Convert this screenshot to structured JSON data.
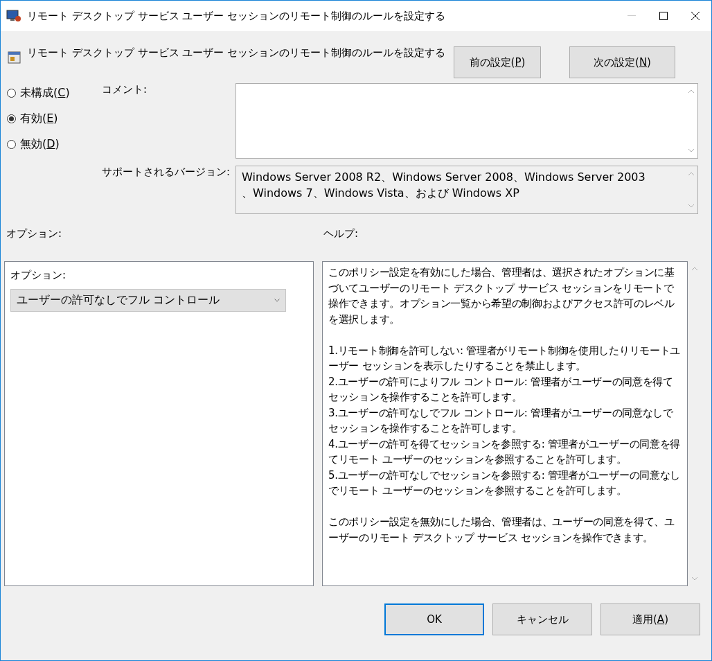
{
  "window": {
    "title": "リモート デスクトップ サービス ユーザー セッションのリモート制御のルールを設定する"
  },
  "policy_title": "リモート デスクトップ サービス ユーザー セッションのリモート制御のルールを設定する",
  "nav_buttons": [
    {
      "before": "前の設定(",
      "key": "P",
      "after": ")"
    },
    {
      "before": "次の設定(",
      "key": "N",
      "after": ")"
    }
  ],
  "states": [
    {
      "before": "未構成(",
      "key": "C",
      "after": ")",
      "selected": false
    },
    {
      "before": "有効(",
      "key": "E",
      "after": ")",
      "selected": true
    },
    {
      "before": "無効(",
      "key": "D",
      "after": ")",
      "selected": false
    }
  ],
  "comment": {
    "label": "コメント:"
  },
  "supported": {
    "label": "サポートされるバージョン:",
    "lines": [
      "Windows Server 2008 R2、Windows Server 2008、Windows Server 2003",
      "、Windows 7、Windows Vista、および Windows XP"
    ]
  },
  "options": {
    "heading": "オプション:",
    "label": "オプション:",
    "dropdown_value": "ユーザーの許可なしでフル コントロール"
  },
  "help": {
    "heading": "ヘルプ:",
    "sections": [
      [
        "このポリシー設定を有効にした場合、管理者は、選択されたオプションに基づいてユーザーのリモート デスクトップ サービス セッションをリモートで操作できます。オプション一覧から希望の制御およびアクセス許可のレベルを選択します。"
      ],
      [
        "1.リモート制御を許可しない: 管理者がリモート制御を使用したりリモートユーザー セッションを表示したりすることを禁止します。",
        "2.ユーザーの許可によりフル コントロール: 管理者がユーザーの同意を得てセッションを操作することを許可します。",
        "3.ユーザーの許可なしでフル コントロール: 管理者がユーザーの同意なしでセッションを操作することを許可します。",
        "4.ユーザーの許可を得てセッションを参照する: 管理者がユーザーの同意を得てリモート ユーザーのセッションを参照することを許可します。",
        "5.ユーザーの許可なしでセッションを参照する: 管理者がユーザーの同意なしでリモート ユーザーのセッションを参照することを許可します。"
      ],
      [
        "このポリシー設定を無効にした場合、管理者は、ユーザーの同意を得て、ユーザーのリモート デスクトップ サービス セッションを操作できます。"
      ]
    ]
  },
  "footer_buttons": [
    {
      "before": "OK",
      "selected": true
    },
    {
      "before": "キャンセル",
      "selected": false
    },
    {
      "before": "適用(",
      "key": "A",
      "after": ")",
      "selected": false
    }
  ]
}
